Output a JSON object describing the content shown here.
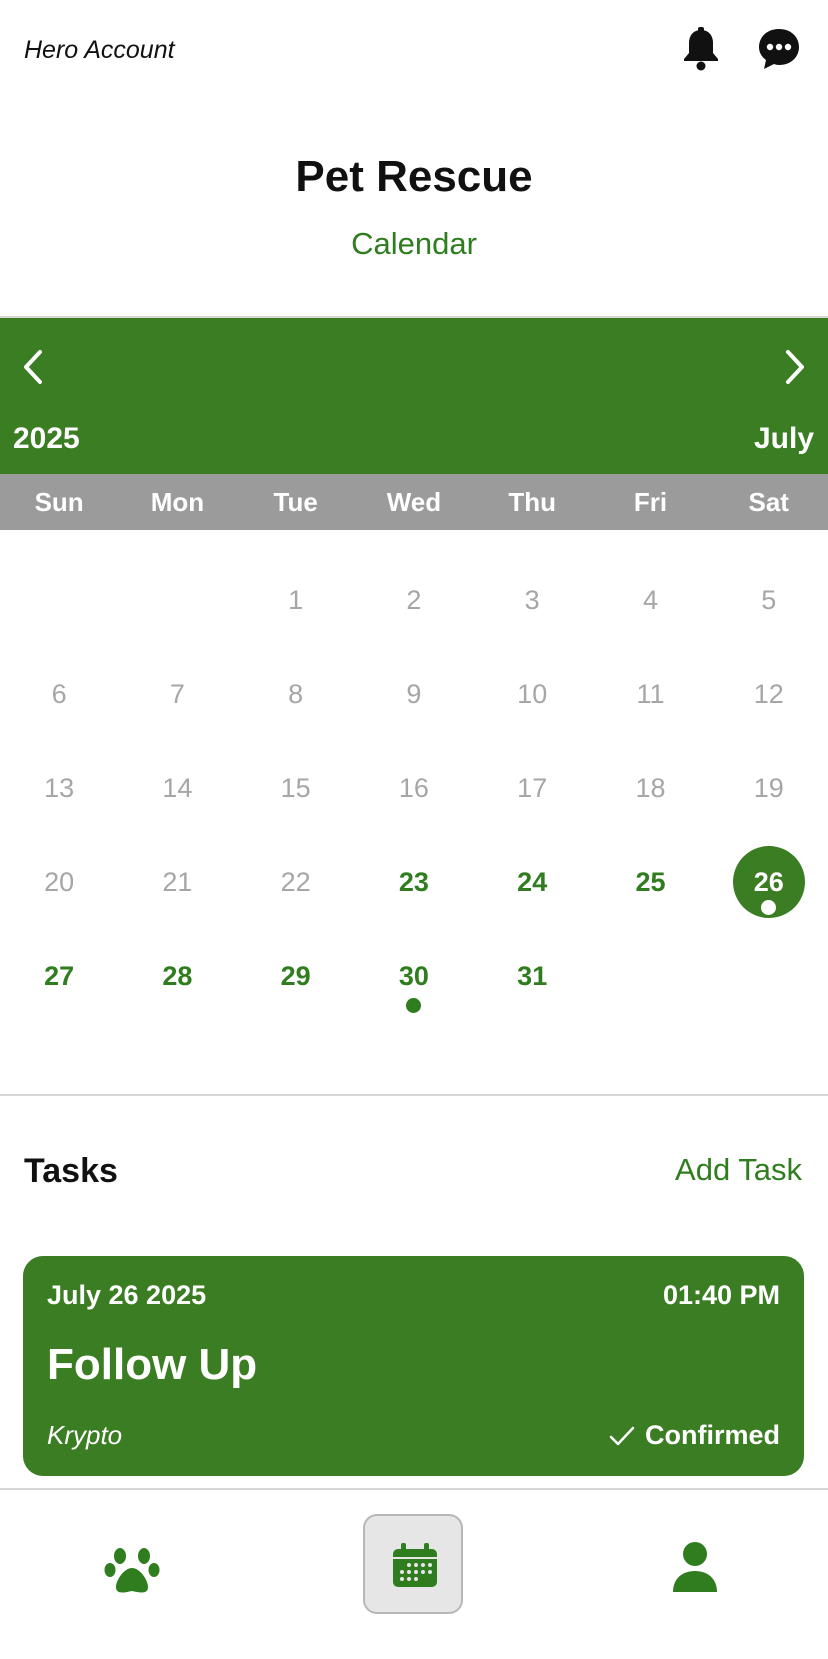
{
  "header": {
    "account_label": "Hero Account",
    "icons": [
      "bell-icon",
      "chat-bubble-icon"
    ]
  },
  "app": {
    "title": "Pet Rescue",
    "subtitle": "Calendar"
  },
  "calendar": {
    "year": "2025",
    "month": "July",
    "prev_icon": "chevron-left-icon",
    "next_icon": "chevron-right-icon",
    "weekdays": [
      "Sun",
      "Mon",
      "Tue",
      "Wed",
      "Thu",
      "Fri",
      "Sat"
    ],
    "weeks": [
      [
        "",
        "",
        "1",
        "2",
        "3",
        "4",
        "5"
      ],
      [
        "6",
        "7",
        "8",
        "9",
        "10",
        "11",
        "12"
      ],
      [
        "13",
        "14",
        "15",
        "16",
        "17",
        "18",
        "19"
      ],
      [
        "20",
        "21",
        "22",
        "23",
        "24",
        "25",
        "26"
      ],
      [
        "27",
        "28",
        "29",
        "30",
        "31",
        "",
        ""
      ]
    ],
    "selected_day": "26",
    "active_days": [
      "23",
      "24",
      "25",
      "26",
      "27",
      "28",
      "29",
      "30",
      "31"
    ],
    "event_days": [
      "26",
      "30"
    ]
  },
  "tasks": {
    "title": "Tasks",
    "add_label": "Add Task",
    "items": [
      {
        "date": "July 26 2025",
        "time": "01:40 PM",
        "title": "Follow Up",
        "pet": "Krypto",
        "status": "Confirmed"
      }
    ]
  },
  "bottom_nav": {
    "items": [
      "paw-icon",
      "calendar-icon",
      "person-icon"
    ],
    "active": "calendar-icon"
  },
  "colors": {
    "accent": "#3a7d22",
    "text_green": "#2f7d1f",
    "weekday_bar": "#9b9b9b",
    "inactive_day": "#a6a6a6"
  }
}
